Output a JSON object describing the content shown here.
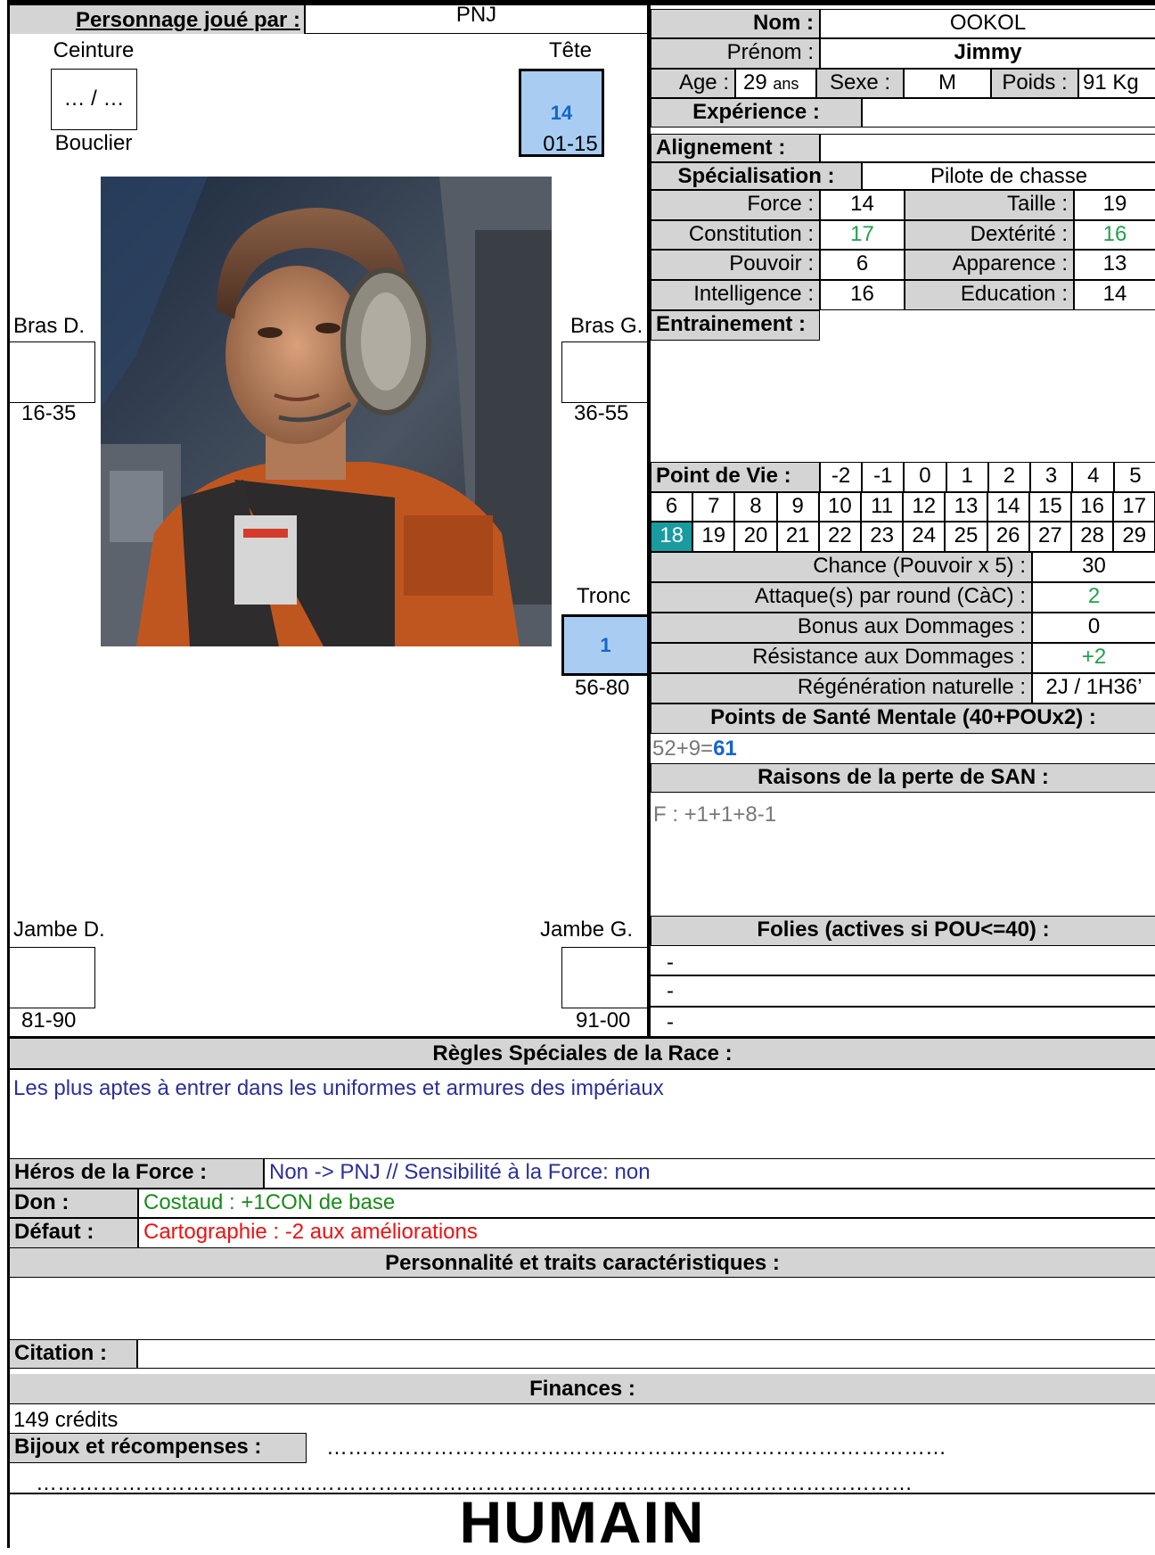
{
  "header": {
    "player_label": "Personnage joué par :",
    "player_value": "PNJ",
    "name_label": "Nom :",
    "name_value": "OOKOL",
    "firstname_label": "Prénom :",
    "firstname_value": "Jimmy",
    "age_label": "Age :",
    "age_value": "29",
    "age_unit": "ans",
    "sex_label": "Sexe :",
    "sex_value": "M",
    "weight_label": "Poids :",
    "weight_value": "91",
    "weight_unit": "Kg",
    "experience_label": "Expérience :",
    "alignment_label": "Alignement :",
    "specialisation_label": "Spécialisation :",
    "specialisation_value": "Pilote de chasse"
  },
  "body": {
    "belt_label": "Ceinture",
    "belt_value": "… / …",
    "shield_label": "Bouclier",
    "head_label": "Tête",
    "head_value": "14",
    "head_range": "01-15",
    "right_arm_label": "Bras D.",
    "right_arm_range": "16-35",
    "left_arm_label": "Bras G.",
    "left_arm_range": "36-55",
    "torso_label": "Tronc",
    "torso_value": "1",
    "torso_range": "56-80",
    "right_leg_label": "Jambe D.",
    "right_leg_range": "81-90",
    "left_leg_label": "Jambe G.",
    "left_leg_range": "91-00"
  },
  "stats": [
    {
      "label": "Force :",
      "value": "14",
      "label2": "Taille :",
      "value2": "19"
    },
    {
      "label": "Constitution :",
      "value": "17",
      "label2": "Dextérité :",
      "value2": "16"
    },
    {
      "label": "Pouvoir :",
      "value": "6",
      "label2": "Apparence :",
      "value2": "13"
    },
    {
      "label": "Intelligence :",
      "value": "16",
      "label2": "Education :",
      "value2": "14"
    }
  ],
  "training_label": "Entrainement :",
  "hp": {
    "label": "Point de Vie :",
    "row1": [
      "-2",
      "-1",
      "0",
      "1",
      "2",
      "3",
      "4",
      "5"
    ],
    "row2": [
      "6",
      "7",
      "8",
      "9",
      "10",
      "11",
      "12",
      "13",
      "14",
      "15",
      "16",
      "17"
    ],
    "row3": [
      "18",
      "19",
      "20",
      "21",
      "22",
      "23",
      "24",
      "25",
      "26",
      "27",
      "28",
      "29"
    ],
    "current": "18",
    "current_color": "#1a9ba0"
  },
  "derived": [
    {
      "label": "Chance (Pouvoir x 5) :",
      "value": "30"
    },
    {
      "label": "Attaque(s) par round (CàC) :",
      "value": "2"
    },
    {
      "label": "Bonus aux Dommages :",
      "value": "0"
    },
    {
      "label": "Résistance aux Dommages :",
      "value": "+2"
    },
    {
      "label": "Régénération naturelle :",
      "value": "2J / 1H36’"
    }
  ],
  "sanity": {
    "title": "Points de Santé Mentale (40+POUx2) :",
    "formula": "52+9=",
    "total": "61",
    "loss_title": "Raisons de la perte de SAN :",
    "loss_value": "F : +1+1+8-1",
    "madness_title": "Folies (actives si POU<=40) :",
    "madness_items": [
      "-",
      "-",
      "-"
    ]
  },
  "race_rules": {
    "title": "Règles Spéciales de la Race :",
    "text": "Les plus aptes à entrer dans les uniformes et armures des impériaux"
  },
  "force_hero_label": "Héros de la Force :",
  "force_hero_value": "Non -> PNJ // Sensibilité à la Force: non",
  "gift_label": "Don :",
  "gift_value": "Costaud : +1CON de base",
  "flaw_label": "Défaut :",
  "flaw_value": "Cartographie : -2 aux améliorations",
  "personality_title": "Personnalité et traits caractéristiques :",
  "quote_label": "Citation :",
  "finances_title": "Finances :",
  "finances_value": "149 crédits",
  "jewels_label": "Bijoux et récompenses :",
  "jewels_dots": "……………………………………………………………………………",
  "dots_line": "……………………………………………………………………………………………………………",
  "race_name": "HUMAIN",
  "colors": {
    "header_grey": "#d4d4d4",
    "hit_box": "#a9cdf2",
    "hit_text": "#1466c8",
    "hp_current": "#1a9ba0"
  }
}
